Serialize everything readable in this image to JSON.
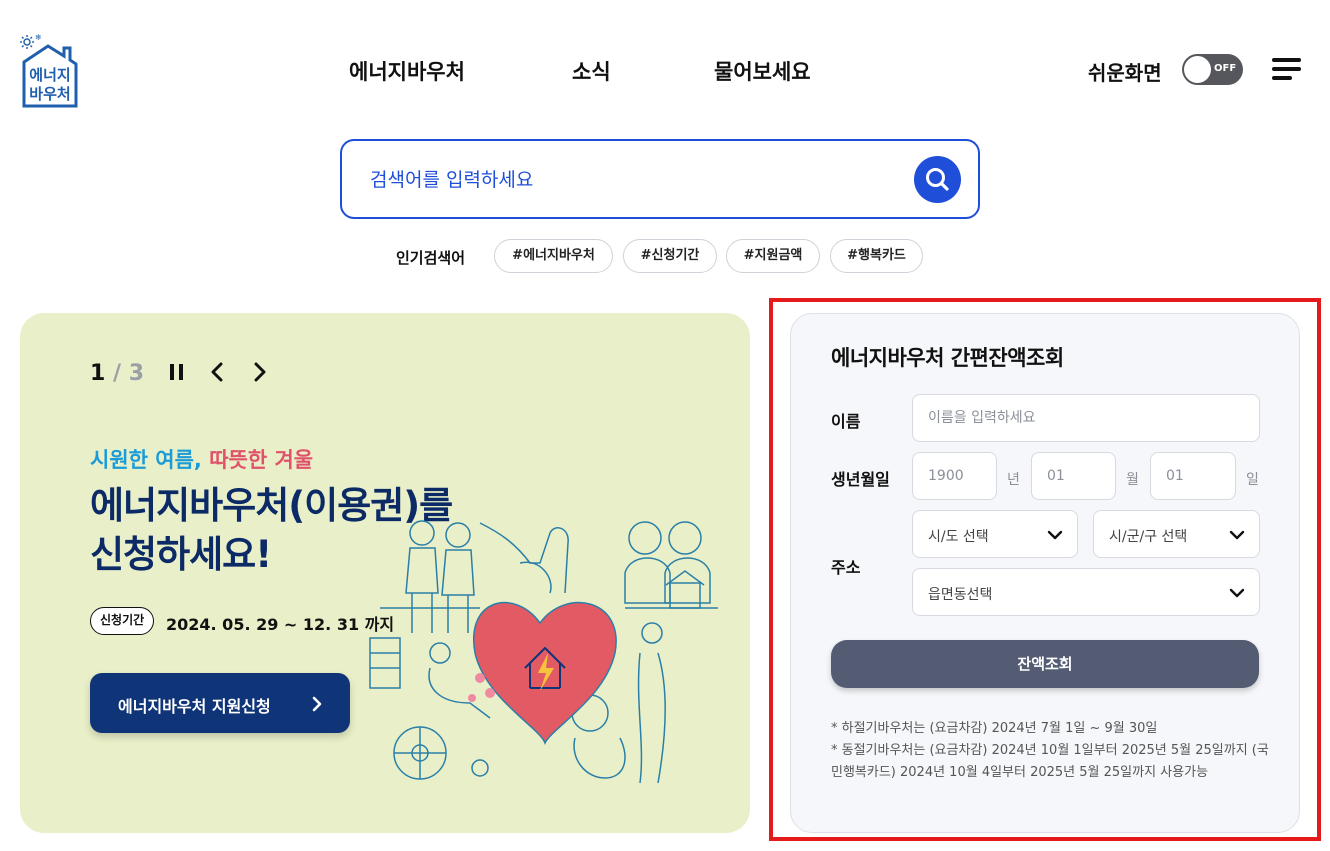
{
  "header": {
    "logo_text": [
      "에너지",
      "바우처"
    ],
    "nav": [
      "에너지바우처",
      "소식",
      "물어보세요"
    ],
    "easy_mode_label": "쉬운화면",
    "toggle_state": "OFF"
  },
  "search": {
    "placeholder": "검색어를 입력하세요",
    "popular_label": "인기검색어",
    "popular_tags": [
      "#에너지바우처",
      "#신청기간",
      "#지원금액",
      "#행복카드"
    ]
  },
  "banner": {
    "current_slide": "1",
    "slide_separator": "/",
    "total_slides": "3",
    "tagline_cool": "시원한 여름,",
    "tagline_warm": "따뜻한 겨울",
    "headline_line1": "에너지바우처(이용권)를",
    "headline_line2": "신청하세요!",
    "period_badge": "신청기간",
    "period_text": "2024. 05. 29 ~ 12. 31 까지",
    "apply_button": "에너지바우처 지원신청"
  },
  "balance_panel": {
    "title": "에너지바우처 간편잔액조회",
    "name_label": "이름",
    "name_placeholder": "이름을 입력하세요",
    "birth_label": "생년월일",
    "birth_year_placeholder": "1900",
    "birth_month_placeholder": "01",
    "birth_day_placeholder": "01",
    "unit_year": "년",
    "unit_month": "월",
    "unit_day": "일",
    "address_label": "주소",
    "sido_select": "시/도 선택",
    "sigungu_select": "시/군/구 선택",
    "eupmyeondong_select": "읍면동선택",
    "check_button": "잔액조회",
    "note1": "* 하절기바우처는 (요금차감) 2024년 7월 1일 ~ 9월 30일",
    "note2": "* 동절기바우처는 (요금차감) 2024년 10월 1일부터 2025년 5월 25일까지 (국민행복카드) 2024년 10월 4일부터 2025년 5월 25일까지 사용가능"
  },
  "colors": {
    "accent_blue": "#1f4fd9",
    "navy": "#0f3478",
    "banner_bg": "#e9f0c9",
    "highlight_red": "#e51a1a",
    "button_slate": "#535c73"
  },
  "icons": [
    "logo-house-icon",
    "hamburger-menu-icon",
    "search-icon",
    "pause-icon",
    "chevron-left-icon",
    "chevron-right-icon",
    "chevron-down-icon",
    "heart-energy-illustration"
  ]
}
